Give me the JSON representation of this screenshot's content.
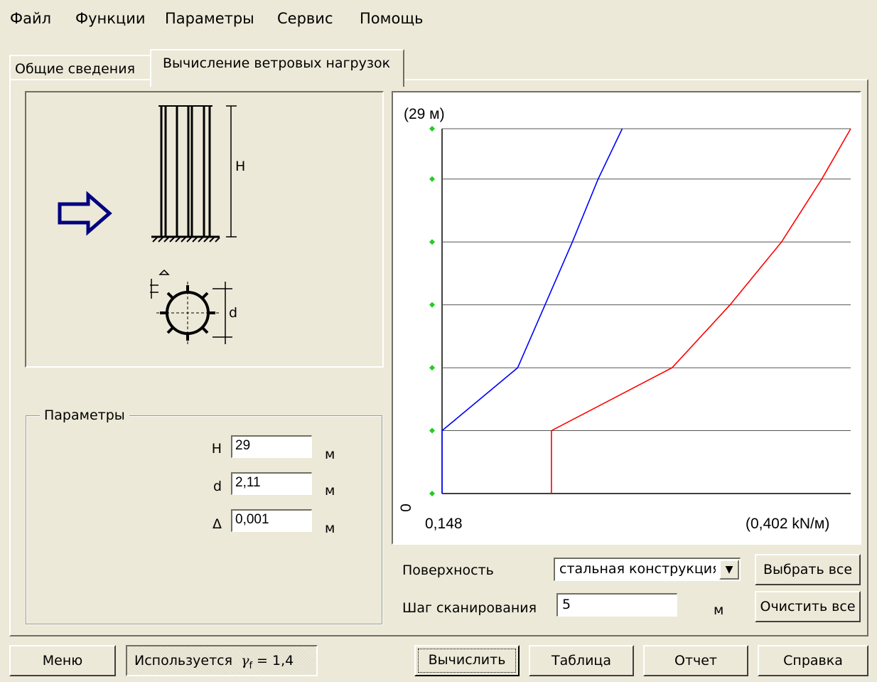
{
  "menu": [
    "Файл",
    "Функции",
    "Параметры",
    "Сервис",
    "Помощь"
  ],
  "tabs": [
    "Общие сведения",
    "Вычисление ветровых нагрузок"
  ],
  "schema": {
    "height_label": "H",
    "diameter_label": "d"
  },
  "params": {
    "legend": "Параметры",
    "fields": [
      {
        "label": "H",
        "value": "29",
        "unit": "м"
      },
      {
        "label": "d",
        "value": "2,11",
        "unit": "м"
      },
      {
        "label": "Δ",
        "value": "0,001",
        "unit": "м"
      }
    ]
  },
  "chart": {
    "y_top_label": "(29 м)",
    "y_zero_label": "0",
    "x_min_label": "0,148",
    "x_max_label": "(0,402 kN/м)",
    "colors": {
      "series1": "#0000ff",
      "series2": "#ff0000",
      "markers": "#22cc22",
      "grid": "#000000"
    }
  },
  "chart_data": {
    "type": "line",
    "xlabel": "",
    "ylabel": "",
    "xlim": [
      0.148,
      0.402
    ],
    "ylim": [
      0,
      29
    ],
    "y_gridlines": [
      0,
      5,
      10,
      15,
      20,
      25,
      29
    ],
    "series": [
      {
        "points": [
          [
            0.148,
            0
          ],
          [
            0.148,
            5
          ],
          [
            0.195,
            10
          ],
          [
            0.212,
            15
          ],
          [
            0.229,
            20
          ],
          [
            0.245,
            25
          ],
          [
            0.26,
            29
          ]
        ]
      },
      {
        "points": [
          [
            0.216,
            0
          ],
          [
            0.216,
            5
          ],
          [
            0.291,
            10
          ],
          [
            0.327,
            15
          ],
          [
            0.359,
            20
          ],
          [
            0.384,
            25
          ],
          [
            0.402,
            29
          ]
        ]
      }
    ]
  },
  "surface": {
    "label": "Поверхность",
    "value": "стальная конструкция"
  },
  "scan": {
    "label": "Шаг сканирования",
    "value": "5",
    "unit": "м"
  },
  "buttons": {
    "select_all": "Выбрать все",
    "clear_all": "Очистить все",
    "menu": "Меню",
    "compute": "Вычислить",
    "table": "Таблица",
    "report": "Отчет",
    "help": "Справка"
  },
  "status": {
    "prefix": "Используется",
    "gamma_symbol": "γ",
    "gamma_sub": "f",
    "value": " = 1,4"
  }
}
